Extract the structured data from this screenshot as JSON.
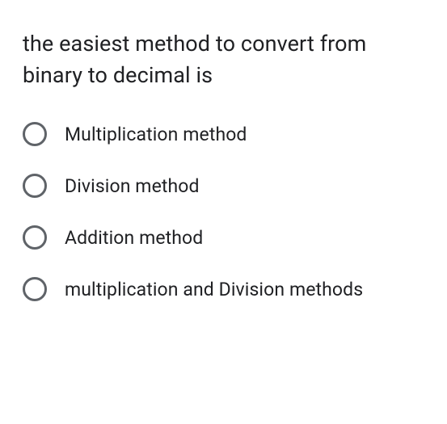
{
  "question": {
    "text": "the easiest method to convert from binary to decimal is"
  },
  "options": [
    {
      "label": "Multiplication method"
    },
    {
      "label": "Division method"
    },
    {
      "label": "Addition method"
    },
    {
      "label": "multiplication and Division methods"
    }
  ]
}
